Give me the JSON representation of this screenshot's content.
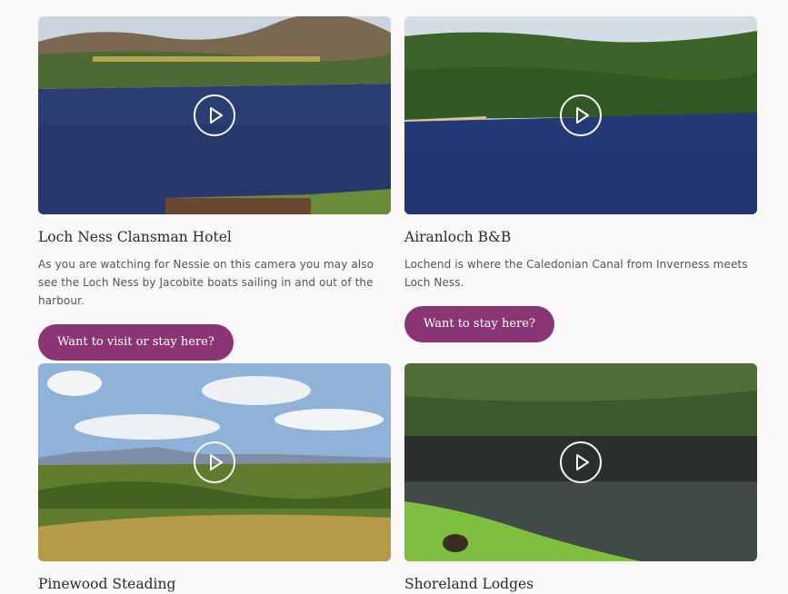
{
  "cards": [
    {
      "title": "Loch Ness Clansman Hotel",
      "description": "As you are watching for Nessie on this camera you may also see the Loch Ness by Jacobite boats sailing in and out of the harbour.",
      "button_label": "Want to visit or stay here?"
    },
    {
      "title": "Airanloch B&B",
      "description": "Lochend is where the Caledonian Canal from Inverness meets Loch Ness.",
      "button_label": "Want to stay here?"
    },
    {
      "title": "Pinewood Steading",
      "description": "",
      "button_label": ""
    },
    {
      "title": "Shoreland Lodges",
      "description": "",
      "button_label": ""
    }
  ],
  "icons": {
    "play": "play-icon"
  },
  "colors": {
    "background": "#faf9f7",
    "button": "#8c3574",
    "button_text": "#ffffff",
    "title_text": "#2b2b2b",
    "body_text": "#555555"
  }
}
